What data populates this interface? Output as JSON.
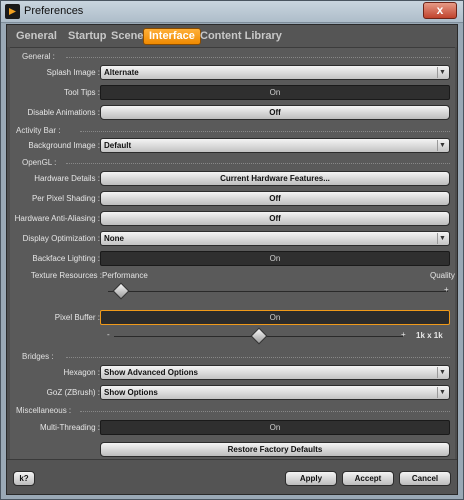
{
  "window": {
    "title": "Preferences",
    "close_symbol": "x"
  },
  "tabs": [
    {
      "label": "General"
    },
    {
      "label": "Startup"
    },
    {
      "label": "Scene"
    },
    {
      "label": "Interface"
    },
    {
      "label": "Content Library"
    }
  ],
  "sections": {
    "general": "General :",
    "activity_bar": "Activity Bar :",
    "opengl": "OpenGL :",
    "bridges": "Bridges :",
    "misc": "Miscellaneous :"
  },
  "general": {
    "splash_label": "Splash Image :",
    "splash_value": "Alternate",
    "tooltips_label": "Tool Tips :",
    "tooltips_value": "On",
    "anim_label": "Disable Animations :",
    "anim_value": "Off"
  },
  "activity": {
    "bg_label": "Background Image :",
    "bg_value": "Default"
  },
  "opengl": {
    "hw_label": "Hardware Details :",
    "hw_button": "Current Hardware Features...",
    "pps_label": "Per Pixel Shading :",
    "pps_value": "Off",
    "aa_label": "Hardware Anti-Aliasing :",
    "aa_value": "Off",
    "disp_label": "Display Optimization :",
    "disp_value": "None",
    "bfl_label": "Backface Lighting :",
    "bfl_value": "On",
    "tex_label": "Texture Resources :",
    "tex_left": "Performance",
    "tex_right": "Quality",
    "tex_level": 0.02,
    "pb_label": "Pixel Buffer :",
    "pb_value": "On",
    "pb_minus": "-",
    "pb_plus": "+",
    "pb_size": "1k x 1k",
    "pb_level": 0.5,
    "tex_plus": "+"
  },
  "bridges": {
    "hex_label": "Hexagon :",
    "hex_value": "Show Advanced Options",
    "goz_label": "GoZ (ZBrush) :",
    "goz_value": "Show Options"
  },
  "misc": {
    "mt_label": "Multi-Threading :",
    "mt_value": "On",
    "restore": "Restore Factory Defaults"
  },
  "footer": {
    "help": "k?",
    "apply": "Apply",
    "accept": "Accept",
    "cancel": "Cancel"
  }
}
